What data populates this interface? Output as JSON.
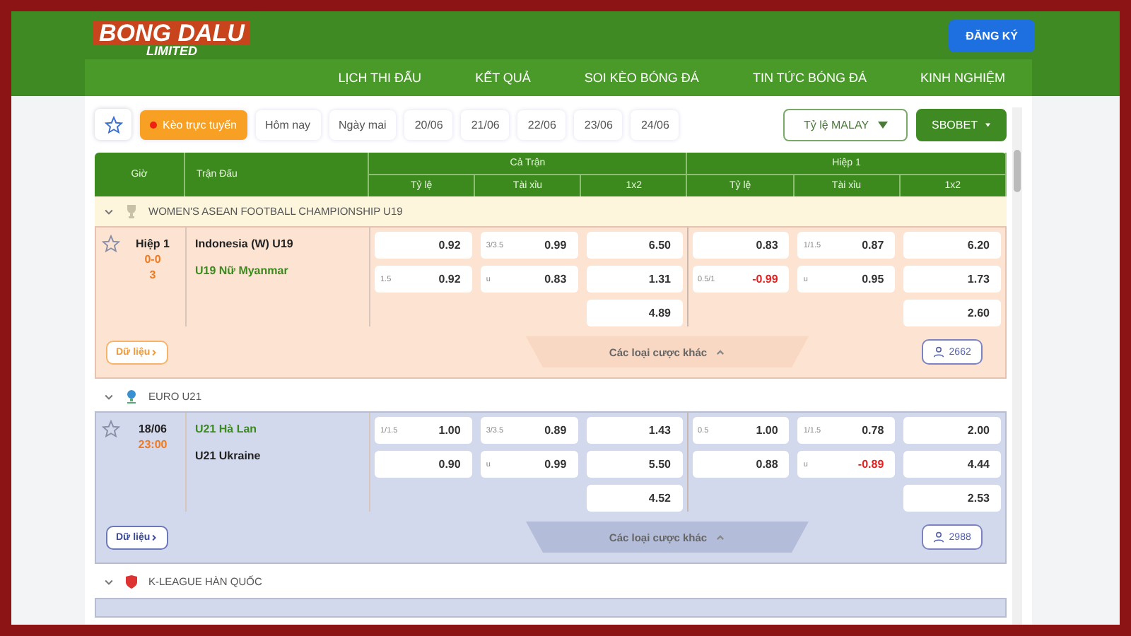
{
  "header": {
    "logo": {
      "name": "BONG DALU",
      "tagline": "LIMITED"
    },
    "register_button": "ĐĂNG KÝ",
    "nav": [
      "LỊCH THI ĐẤU",
      "KẾT QUẢ",
      "SOI KÈO BÓNG ĐÁ",
      "TIN TỨC BÓNG ĐÁ",
      "KINH NGHIỆM"
    ]
  },
  "filters": {
    "items": [
      {
        "label": "Kèo trực tuyến",
        "selected": true
      },
      {
        "label": "Hôm nay",
        "selected": false
      },
      {
        "label": "Ngày mai",
        "selected": false
      },
      {
        "label": "20/06",
        "selected": false
      },
      {
        "label": "21/06",
        "selected": false
      },
      {
        "label": "22/06",
        "selected": false
      },
      {
        "label": "23/06",
        "selected": false
      },
      {
        "label": "24/06",
        "selected": false
      }
    ],
    "odds_format": "Tỷ lệ MALAY",
    "bookmaker": "SBOBET"
  },
  "table": {
    "columns": [
      "Giờ",
      "Trận Đấu"
    ],
    "groups": [
      {
        "label": "Cả Trận",
        "columns": [
          "Tỷ lệ",
          "Tài xỉu",
          "1x2"
        ]
      },
      {
        "label": "Hiệp 1",
        "columns": [
          "Tỷ lệ",
          "Tài xỉu",
          "1x2"
        ]
      }
    ],
    "leagues": [
      {
        "name": "WOMEN'S ASEAN FOOTBALL CHAMPIONSHIP U19",
        "expanded": true,
        "matches": [
          {
            "live": true,
            "time": {
              "label": "Hiệp 1",
              "score": "0-0",
              "minute": "3"
            },
            "teams": [
              {
                "name": "Indonesia (W) U19",
                "favorite": false
              },
              {
                "name": "U19 Nữ Myanmar",
                "favorite": true
              }
            ],
            "odds": [
              [
                {
                  "value": "0.92",
                  "negative": false
                },
                {
                  "line": "1.5",
                  "value": "0.92",
                  "negative": false
                }
              ],
              [
                {
                  "line": "3/3.5",
                  "value": "0.99",
                  "negative": false
                },
                {
                  "line": "u",
                  "value": "0.83",
                  "negative": false
                }
              ],
              [
                {
                  "value": "6.50",
                  "negative": false
                },
                {
                  "value": "1.31",
                  "negative": false
                },
                {
                  "value": "4.89",
                  "negative": false
                }
              ],
              [
                {
                  "value": "0.83",
                  "negative": false
                },
                {
                  "line": "0.5/1",
                  "value": "-0.99",
                  "negative": true
                }
              ],
              [
                {
                  "line": "1/1.5",
                  "value": "0.87",
                  "negative": false
                },
                {
                  "line": "u",
                  "value": "0.95",
                  "negative": false
                }
              ],
              [
                {
                  "value": "6.20",
                  "negative": false
                },
                {
                  "value": "1.73",
                  "negative": false
                },
                {
                  "value": "2.60",
                  "negative": false
                }
              ]
            ],
            "data_button": "Dữ liệu",
            "more_bets": "Các loại cược khác",
            "bettors": "2662"
          }
        ]
      },
      {
        "name": "EURO U21",
        "expanded": true,
        "matches": [
          {
            "live": false,
            "time": {
              "label": "18/06",
              "kickoff": "23:00"
            },
            "teams": [
              {
                "name": "U21 Hà Lan",
                "favorite": true
              },
              {
                "name": "U21 Ukraine",
                "favorite": false
              }
            ],
            "odds": [
              [
                {
                  "line": "1/1.5",
                  "value": "1.00",
                  "negative": false
                },
                {
                  "value": "0.90",
                  "negative": false
                }
              ],
              [
                {
                  "line": "3/3.5",
                  "value": "0.89",
                  "negative": false
                },
                {
                  "line": "u",
                  "value": "0.99",
                  "negative": false
                }
              ],
              [
                {
                  "value": "1.43",
                  "negative": false
                },
                {
                  "value": "5.50",
                  "negative": false
                },
                {
                  "value": "4.52",
                  "negative": false
                }
              ],
              [
                {
                  "line": "0.5",
                  "value": "1.00",
                  "negative": false
                },
                {
                  "value": "0.88",
                  "negative": false
                }
              ],
              [
                {
                  "line": "1/1.5",
                  "value": "0.78",
                  "negative": false
                },
                {
                  "line": "u",
                  "value": "-0.89",
                  "negative": true
                }
              ],
              [
                {
                  "value": "2.00",
                  "negative": false
                },
                {
                  "value": "4.44",
                  "negative": false
                },
                {
                  "value": "2.53",
                  "negative": false
                }
              ]
            ],
            "data_button": "Dữ liệu",
            "more_bets": "Các loại cược khác",
            "bettors": "2988"
          }
        ]
      },
      {
        "name": "K-LEAGUE HÀN QUỐC",
        "expanded": true
      }
    ]
  }
}
